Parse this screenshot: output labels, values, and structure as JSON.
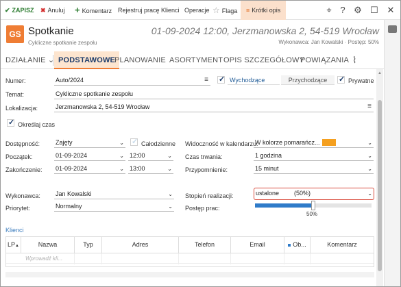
{
  "toolbar": {
    "save": "ZAPISZ",
    "cancel": "Anuluj",
    "comment": "Komentarz",
    "register_work": "Rejestruj pracę",
    "clients": "Klienci",
    "operations": "Operacje",
    "flag": "Flaga",
    "short_desc": "Krótki opis"
  },
  "header": {
    "logo": "GS",
    "title": "Spotkanie",
    "subtitle": "Cykliczne spotkanie zespołu",
    "datetime_location": "01-09-2024 12:00, Jerzmanowska 2, 54-519 Wrocław",
    "meta": "Wykonawca: Jan Kowalski  ·  Postęp: 50%"
  },
  "tabs": {
    "action": "DZIAŁANIE",
    "basic": "PODSTAWOWE",
    "planning": "PLANOWANIE",
    "assortment": "ASORTYMENT",
    "detailed": "OPIS SZCZEGÓŁOWY",
    "relations": "POWIĄZANIA"
  },
  "form": {
    "number_label": "Numer:",
    "number_value": "Auto/2024",
    "outgoing": "Wychodzące",
    "incoming": "Przychodzące",
    "private": "Prywatne",
    "subject_label": "Temat:",
    "subject_value": "Cykliczne spotkanie zespołu",
    "location_label": "Lokalizacja:",
    "location_value": "Jerzmanowska 2, 54-519 Wrocław",
    "define_time": "Określaj czas",
    "availability_label": "Dostępność:",
    "availability_value": "Zajęty",
    "all_day": "Całodzienne",
    "calendar_vis_label": "Widoczność w kalendarzu:",
    "calendar_vis_value": "W kolorze pomarańcz...",
    "start_label": "Początek:",
    "start_date": "01-09-2024",
    "start_time": "12:00",
    "duration_label": "Czas trwania:",
    "duration_value": "1 godzina",
    "end_label": "Zakończenie:",
    "end_date": "01-09-2024",
    "end_time": "13:00",
    "reminder_label": "Przypomnienie:",
    "reminder_value": "15 minut",
    "executor_label": "Wykonawca:",
    "executor_value": "Jan Kowalski",
    "completion_label": "Stopień realizacji:",
    "completion_value": "ustalone",
    "completion_percent": "(50%)",
    "priority_label": "Priorytet:",
    "priority_value": "Normalny",
    "progress_label": "Postęp prac:",
    "progress_value": "50%",
    "progress_fraction": 0.5
  },
  "clients": {
    "section_title": "Klienci",
    "columns": [
      "LP",
      "Nazwa",
      "Typ",
      "Adres",
      "Telefon",
      "Email",
      "Ob...",
      "Komentarz"
    ],
    "placeholder": "Wprowadź kli..."
  },
  "colors": {
    "accent": "#ef7d34",
    "calendar_color": "#f5a020",
    "highlight_border": "#d84a3b",
    "progress": "#2f7bc9"
  }
}
